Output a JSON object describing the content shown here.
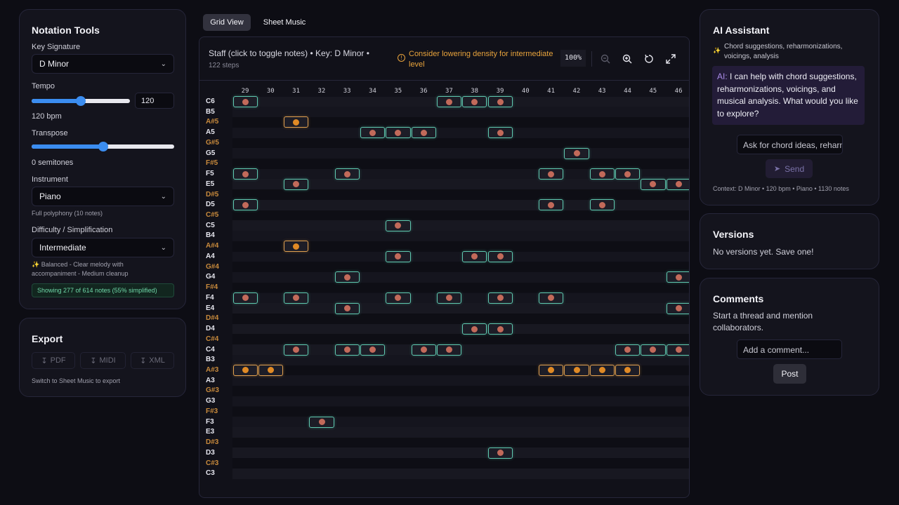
{
  "notation": {
    "title": "Notation Tools",
    "key_label": "Key Signature",
    "key_value": "D Minor",
    "tempo_label": "Tempo",
    "tempo_value": "120",
    "tempo_bpm": "120 bpm",
    "tempo_level": 0.5,
    "transpose_label": "Transpose",
    "transpose_text": "0 semitones",
    "transpose_level": 0.5,
    "instrument_label": "Instrument",
    "instrument_value": "Piano",
    "instrument_note": "Full polyphony (10 notes)",
    "difficulty_label": "Difficulty / Simplification",
    "difficulty_value": "Intermediate",
    "difficulty_desc": "✨ Balanced - Clear melody with accompaniment - Medium cleanup",
    "showing": "Showing 277 of 614 notes (55% simplified)"
  },
  "export": {
    "title": "Export",
    "pdf": "PDF",
    "midi": "MIDI",
    "xml": "XML",
    "hint": "Switch to Sheet Music to export"
  },
  "tabs": {
    "grid": "Grid View",
    "sheet": "Sheet Music"
  },
  "staff": {
    "title": "Staff (click to toggle notes) • Key: D Minor  •",
    "steps": "122 steps",
    "warning": "Consider lowering density for intermediate level",
    "zoom": "100%"
  },
  "grid": {
    "columns": [
      "29",
      "30",
      "31",
      "32",
      "33",
      "34",
      "35",
      "36",
      "37",
      "38",
      "39",
      "40",
      "41",
      "42",
      "43",
      "44",
      "45",
      "46"
    ],
    "pitches": [
      "C6",
      "B5",
      "A#5",
      "A5",
      "G#5",
      "G5",
      "F#5",
      "F5",
      "E5",
      "D#5",
      "D5",
      "C#5",
      "C5",
      "B4",
      "A#4",
      "A4",
      "G#4",
      "G4",
      "F#4",
      "F4",
      "E4",
      "D#4",
      "D4",
      "C#4",
      "C4",
      "B3",
      "A#3",
      "A3",
      "G#3",
      "G3",
      "F#3",
      "F3",
      "E3",
      "D#3",
      "D3",
      "C#3",
      "C3"
    ],
    "notes": [
      {
        "p": "C6",
        "c": [
          29,
          37,
          38,
          39
        ]
      },
      {
        "p": "A#5",
        "c": [
          31
        ]
      },
      {
        "p": "A5",
        "c": [
          34,
          35,
          36,
          39
        ]
      },
      {
        "p": "G5",
        "c": [
          42
        ]
      },
      {
        "p": "F5",
        "c": [
          29,
          33,
          41,
          43,
          44
        ]
      },
      {
        "p": "E5",
        "c": [
          31,
          45,
          46
        ]
      },
      {
        "p": "D5",
        "c": [
          29,
          41,
          43
        ]
      },
      {
        "p": "C5",
        "c": [
          35
        ]
      },
      {
        "p": "A#4",
        "c": [
          31
        ]
      },
      {
        "p": "A4",
        "c": [
          35,
          38,
          39
        ]
      },
      {
        "p": "G4",
        "c": [
          33,
          46
        ]
      },
      {
        "p": "F4",
        "c": [
          29,
          31,
          35,
          37,
          39,
          41
        ]
      },
      {
        "p": "E4",
        "c": [
          33,
          46
        ]
      },
      {
        "p": "D4",
        "c": [
          38,
          39
        ]
      },
      {
        "p": "C4",
        "c": [
          31,
          33,
          34,
          36,
          37,
          44,
          45,
          46
        ]
      },
      {
        "p": "A#3",
        "c": [
          29,
          30,
          41,
          42,
          43,
          44
        ]
      },
      {
        "p": "F3",
        "c": [
          32
        ]
      },
      {
        "p": "D3",
        "c": [
          39
        ]
      }
    ]
  },
  "ai": {
    "title": "AI Assistant",
    "subtitle": "Chord suggestions, reharmonizations, voicings, analysis",
    "message_prefix": "AI:",
    "message": " I can help with chord suggestions, reharmonizations, voicings, and musical analysis. What would you like to explore?",
    "input_placeholder": "Ask for chord ideas, reharmonizations...",
    "send": "Send",
    "context": "Context: D Minor • 120 bpm • Piano • 1130 notes"
  },
  "versions": {
    "title": "Versions",
    "empty": "No versions yet. Save one!"
  },
  "comments": {
    "title": "Comments",
    "hint": "Start a thread and mention collaborators.",
    "placeholder": "Add a comment...",
    "post": "Post"
  }
}
